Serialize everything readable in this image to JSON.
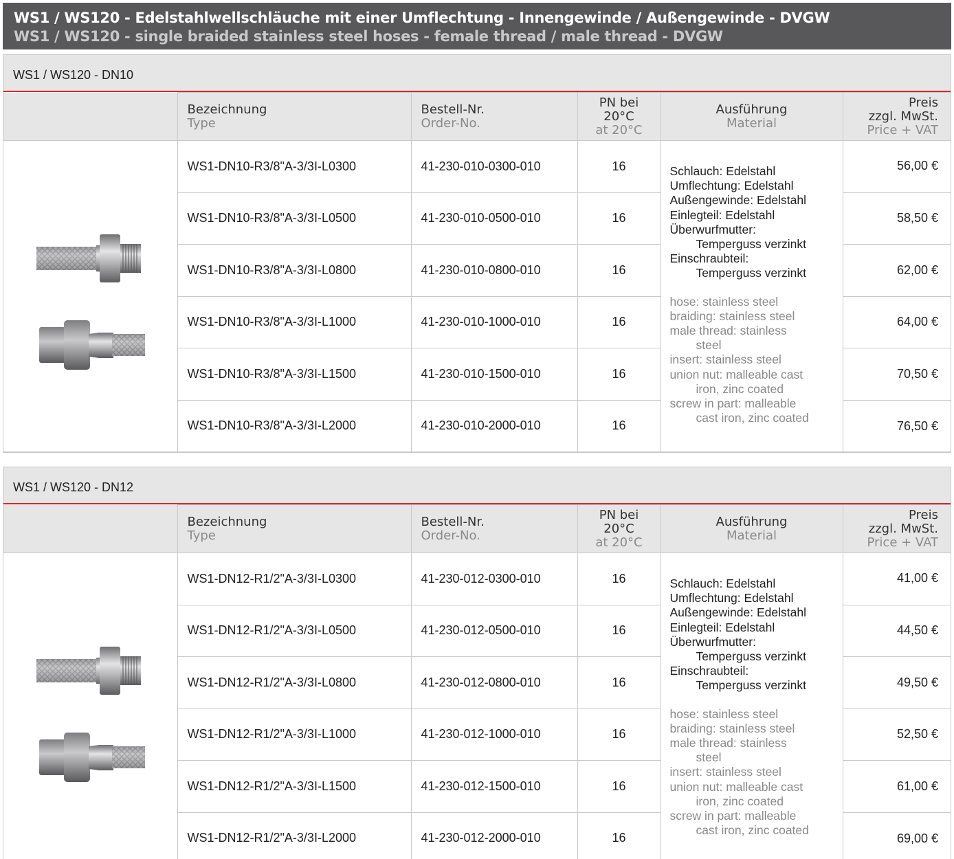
{
  "banner": {
    "title_de": "WS1 / WS120 - Edelstahlwellschläuche mit einer Umflechtung - Innengewinde / Außengewinde - DVGW",
    "title_en": "WS1 / WS120 - single braided stainless steel hoses - female thread / male thread - DVGW"
  },
  "header": {
    "type_de": "Bezeichnung",
    "type_en": "Type",
    "order_de": "Bestell-Nr.",
    "order_en": "Order-No.",
    "pn_de_1": "PN bei",
    "pn_de_2": "20°C",
    "pn_en": "at 20°C",
    "mat_de": "Ausführung",
    "mat_en": "Material",
    "price_de_1": "Preis",
    "price_de_2": "zzgl. MwSt.",
    "price_en": "Price + VAT"
  },
  "material": {
    "de": [
      "Schlauch: Edelstahl",
      "Umflechtung: Edelstahl",
      "Außengewinde: Edelstahl",
      "Einlegteil: Edelstahl",
      "Überwurfmutter:",
      "Temperguss verzinkt",
      "Einschraubteil:",
      "Temperguss verzinkt"
    ],
    "en": [
      "hose: stainless steel",
      "braiding: stainless steel",
      "male thread: stainless",
      "steel",
      "insert: stainless steel",
      "union nut: malleable cast",
      "iron, zinc coated",
      "screw in part: malleable",
      "cast iron, zinc coated"
    ]
  },
  "sections": [
    {
      "title": "WS1 / WS120 - DN10",
      "rows": [
        {
          "type": "WS1-DN10-R3/8\"A-3/3I-L0300",
          "order": "41-230-010-0300-010",
          "pn": "16",
          "price": "56,00 €"
        },
        {
          "type": "WS1-DN10-R3/8\"A-3/3I-L0500",
          "order": "41-230-010-0500-010",
          "pn": "16",
          "price": "58,50 €"
        },
        {
          "type": "WS1-DN10-R3/8\"A-3/3I-L0800",
          "order": "41-230-010-0800-010",
          "pn": "16",
          "price": "62,00 €"
        },
        {
          "type": "WS1-DN10-R3/8\"A-3/3I-L1000",
          "order": "41-230-010-1000-010",
          "pn": "16",
          "price": "64,00 €"
        },
        {
          "type": "WS1-DN10-R3/8\"A-3/3I-L1500",
          "order": "41-230-010-1500-010",
          "pn": "16",
          "price": "70,50 €"
        },
        {
          "type": "WS1-DN10-R3/8\"A-3/3I-L2000",
          "order": "41-230-010-2000-010",
          "pn": "16",
          "price": "76,50 €"
        }
      ]
    },
    {
      "title": "WS1 / WS120 - DN12",
      "rows": [
        {
          "type": "WS1-DN12-R1/2\"A-3/3I-L0300",
          "order": "41-230-012-0300-010",
          "pn": "16",
          "price": "41,00 €"
        },
        {
          "type": "WS1-DN12-R1/2\"A-3/3I-L0500",
          "order": "41-230-012-0500-010",
          "pn": "16",
          "price": "44,50 €"
        },
        {
          "type": "WS1-DN12-R1/2\"A-3/3I-L0800",
          "order": "41-230-012-0800-010",
          "pn": "16",
          "price": "49,50 €"
        },
        {
          "type": "WS1-DN12-R1/2\"A-3/3I-L1000",
          "order": "41-230-012-1000-010",
          "pn": "16",
          "price": "52,50 €"
        },
        {
          "type": "WS1-DN12-R1/2\"A-3/3I-L1500",
          "order": "41-230-012-1500-010",
          "pn": "16",
          "price": "61,00 €"
        },
        {
          "type": "WS1-DN12-R1/2\"A-3/3I-L2000",
          "order": "41-230-012-2000-010",
          "pn": "16",
          "price": "69,00 €"
        }
      ]
    }
  ],
  "colors": {
    "banner_bg": "#58585a",
    "accent_red": "#d9262a",
    "header_bg": "#e6e6e6",
    "subtext_gray": "#8a8a8a"
  }
}
